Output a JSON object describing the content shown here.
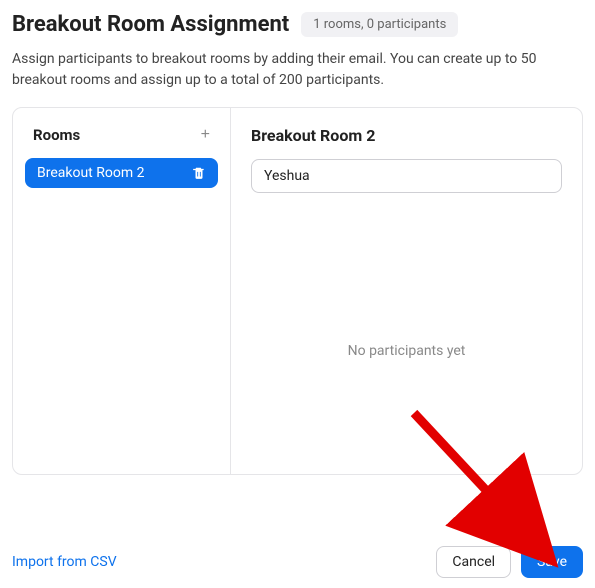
{
  "header": {
    "title": "Breakout Room Assignment",
    "summary": "1 rooms, 0 participants"
  },
  "description": "Assign participants to breakout rooms by adding their email. You can create up to 50 breakout rooms and assign up to a total of 200 participants.",
  "rooms_panel": {
    "title": "Rooms",
    "items": [
      {
        "label": "Breakout Room 2"
      }
    ]
  },
  "main_panel": {
    "room_name": "Breakout Room 2",
    "email_value": "Yeshua",
    "empty_text": "No participants yet"
  },
  "footer": {
    "import_label": "Import from CSV",
    "cancel_label": "Cancel",
    "save_label": "Save"
  }
}
